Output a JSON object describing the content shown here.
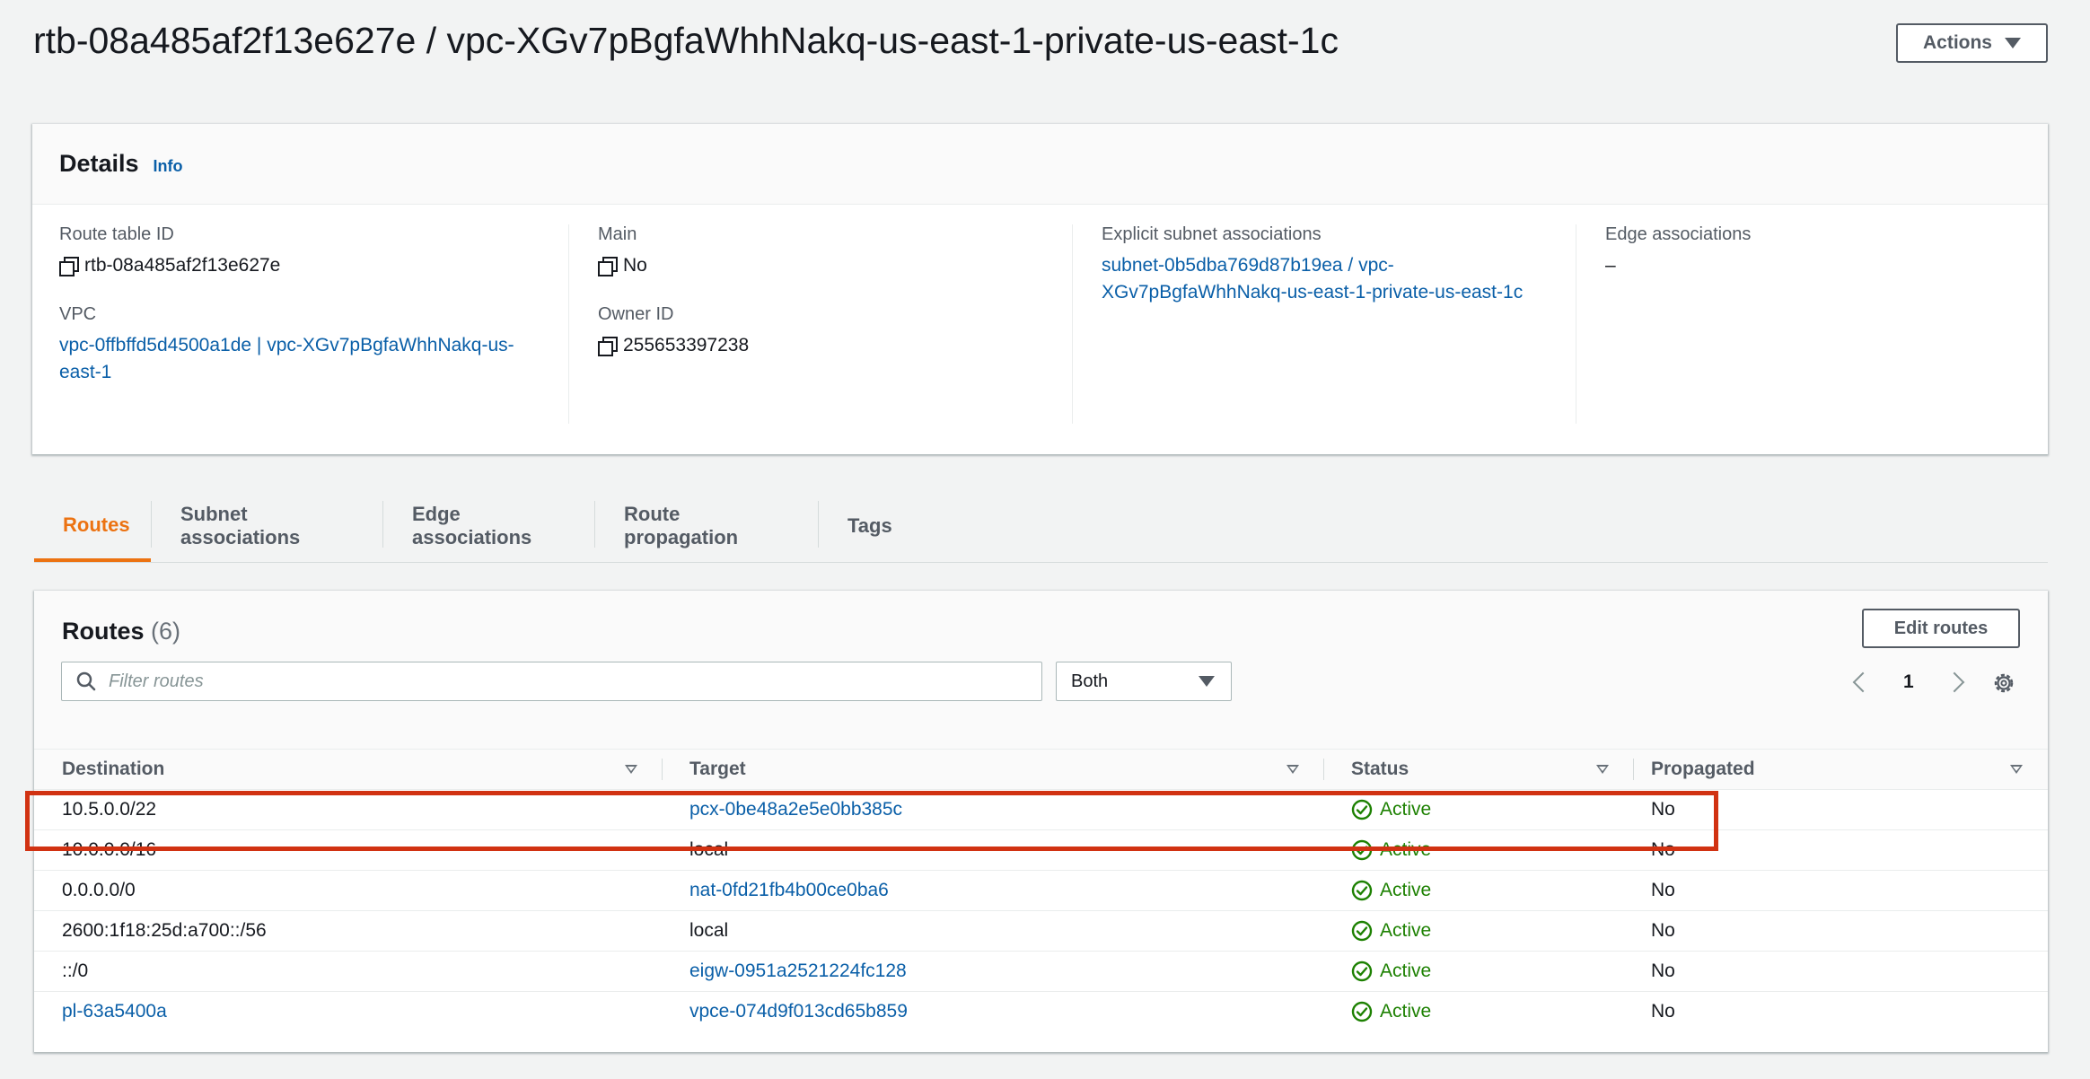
{
  "page": {
    "title": "rtb-08a485af2f13e627e / vpc-XGv7pBgfaWhhNakq-us-east-1-private-us-east-1c",
    "actions_label": "Actions"
  },
  "details": {
    "heading": "Details",
    "info_label": "Info",
    "route_table_id": {
      "label": "Route table ID",
      "value": "rtb-08a485af2f13e627e"
    },
    "vpc": {
      "label": "VPC",
      "value": "vpc-0ffbffd5d4500a1de | vpc-XGv7pBgfaWhhNakq-us-east-1"
    },
    "main": {
      "label": "Main",
      "value": "No"
    },
    "owner_id": {
      "label": "Owner ID",
      "value": "255653397238"
    },
    "explicit_subnet_associations": {
      "label": "Explicit subnet associations",
      "value": "subnet-0b5dba769d87b19ea / vpc-XGv7pBgfaWhhNakq-us-east-1-private-us-east-1c"
    },
    "edge_associations": {
      "label": "Edge associations",
      "value": "–"
    }
  },
  "tabs": [
    {
      "label": "Routes",
      "active": true
    },
    {
      "label": "Subnet associations",
      "active": false
    },
    {
      "label": "Edge associations",
      "active": false
    },
    {
      "label": "Route propagation",
      "active": false
    },
    {
      "label": "Tags",
      "active": false
    }
  ],
  "routes": {
    "title": "Routes",
    "count": "(6)",
    "edit_label": "Edit routes",
    "filter_placeholder": "Filter routes",
    "filter_select": "Both",
    "page_number": "1",
    "columns": [
      "Destination",
      "Target",
      "Status",
      "Propagated"
    ],
    "rows": [
      {
        "destination": "10.5.0.0/22",
        "destination_link": false,
        "target": "pcx-0be48a2e5e0bb385c",
        "target_link": true,
        "status": "Active",
        "propagated": "No",
        "highlighted": true
      },
      {
        "destination": "10.0.0.0/16",
        "destination_link": false,
        "target": "local",
        "target_link": false,
        "status": "Active",
        "propagated": "No",
        "highlighted": false
      },
      {
        "destination": "0.0.0.0/0",
        "destination_link": false,
        "target": "nat-0fd21fb4b00ce0ba6",
        "target_link": true,
        "status": "Active",
        "propagated": "No",
        "highlighted": false
      },
      {
        "destination": "2600:1f18:25d:a700::/56",
        "destination_link": false,
        "target": "local",
        "target_link": false,
        "status": "Active",
        "propagated": "No",
        "highlighted": false
      },
      {
        "destination": "::/0",
        "destination_link": false,
        "target": "eigw-0951a2521224fc128",
        "target_link": true,
        "status": "Active",
        "propagated": "No",
        "highlighted": false
      },
      {
        "destination": "pl-63a5400a",
        "destination_link": true,
        "target": "vpce-074d9f013cd65b859",
        "target_link": true,
        "status": "Active",
        "propagated": "No",
        "highlighted": false
      }
    ]
  },
  "colors": {
    "accent": "#ec7211",
    "link": "#0a5fa8",
    "status_active": "#1d8102",
    "highlight": "#d13212"
  },
  "icons": [
    "copy-icon",
    "search-icon",
    "caret-down-icon",
    "chevron-left-icon",
    "chevron-right-icon",
    "settings-icon",
    "sort-icon",
    "status-check-icon"
  ]
}
